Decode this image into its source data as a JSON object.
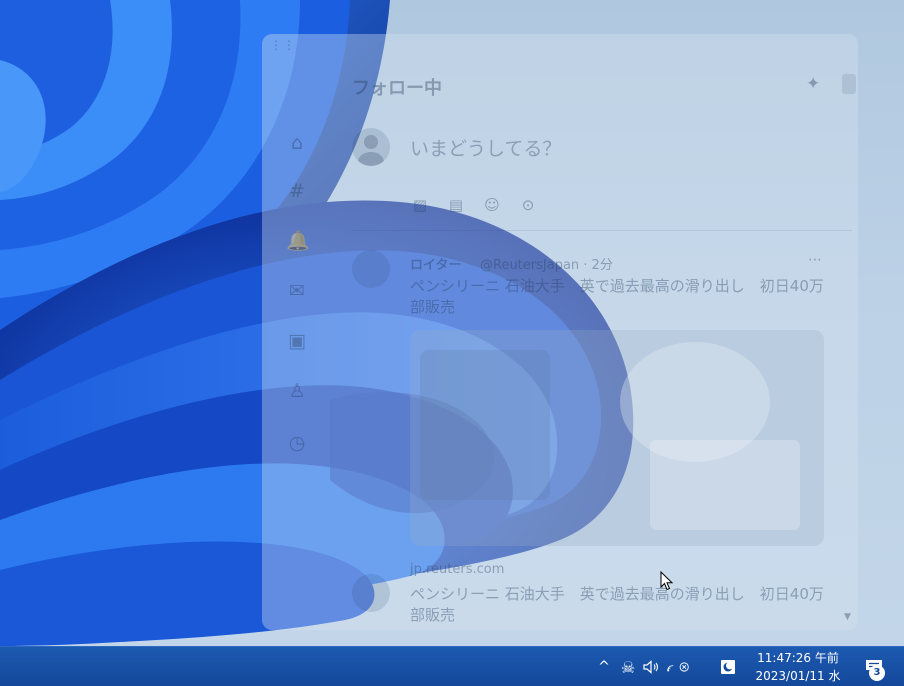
{
  "window": {
    "title": "フォロー中",
    "icons": [
      "sparkle-icon"
    ],
    "nav_icons": [
      "home-icon",
      "explore-icon",
      "bell-icon",
      "mail-icon",
      "bookmark-icon",
      "profile-icon",
      "more-icon"
    ],
    "compose": {
      "placeholder": "いまどうしてる？",
      "tools": [
        "image-icon",
        "gif-icon",
        "emoji-icon",
        "location-icon"
      ]
    },
    "tweet": {
      "author": "ロイター",
      "handle": "@ReutersJapan · 2分",
      "text": "ペンシリーニ 石油大手　英で過去最高の滑り出し　初日40万部販売",
      "media_alt": "news-photo",
      "link": "jp.reuters.com",
      "text_repeat": "ペンシリーニ 石油大手　英で過去最高の滑り出し　初日40万部販売"
    }
  },
  "taskbar": {
    "tray": {
      "overflow_glyph": "^",
      "skull_glyph": "☠",
      "volume_glyph": "🔊",
      "network_glyph": "📶",
      "battery_glyph": "◐"
    },
    "clock": {
      "time": "11:47:26 午前",
      "date": "2023/01/11 水"
    },
    "notifications": {
      "count": "3"
    }
  },
  "colors": {
    "taskbar": "#13489a",
    "wallpaper_accent": "#1a4fd8",
    "desktop_bg": "#bcd1e6"
  }
}
